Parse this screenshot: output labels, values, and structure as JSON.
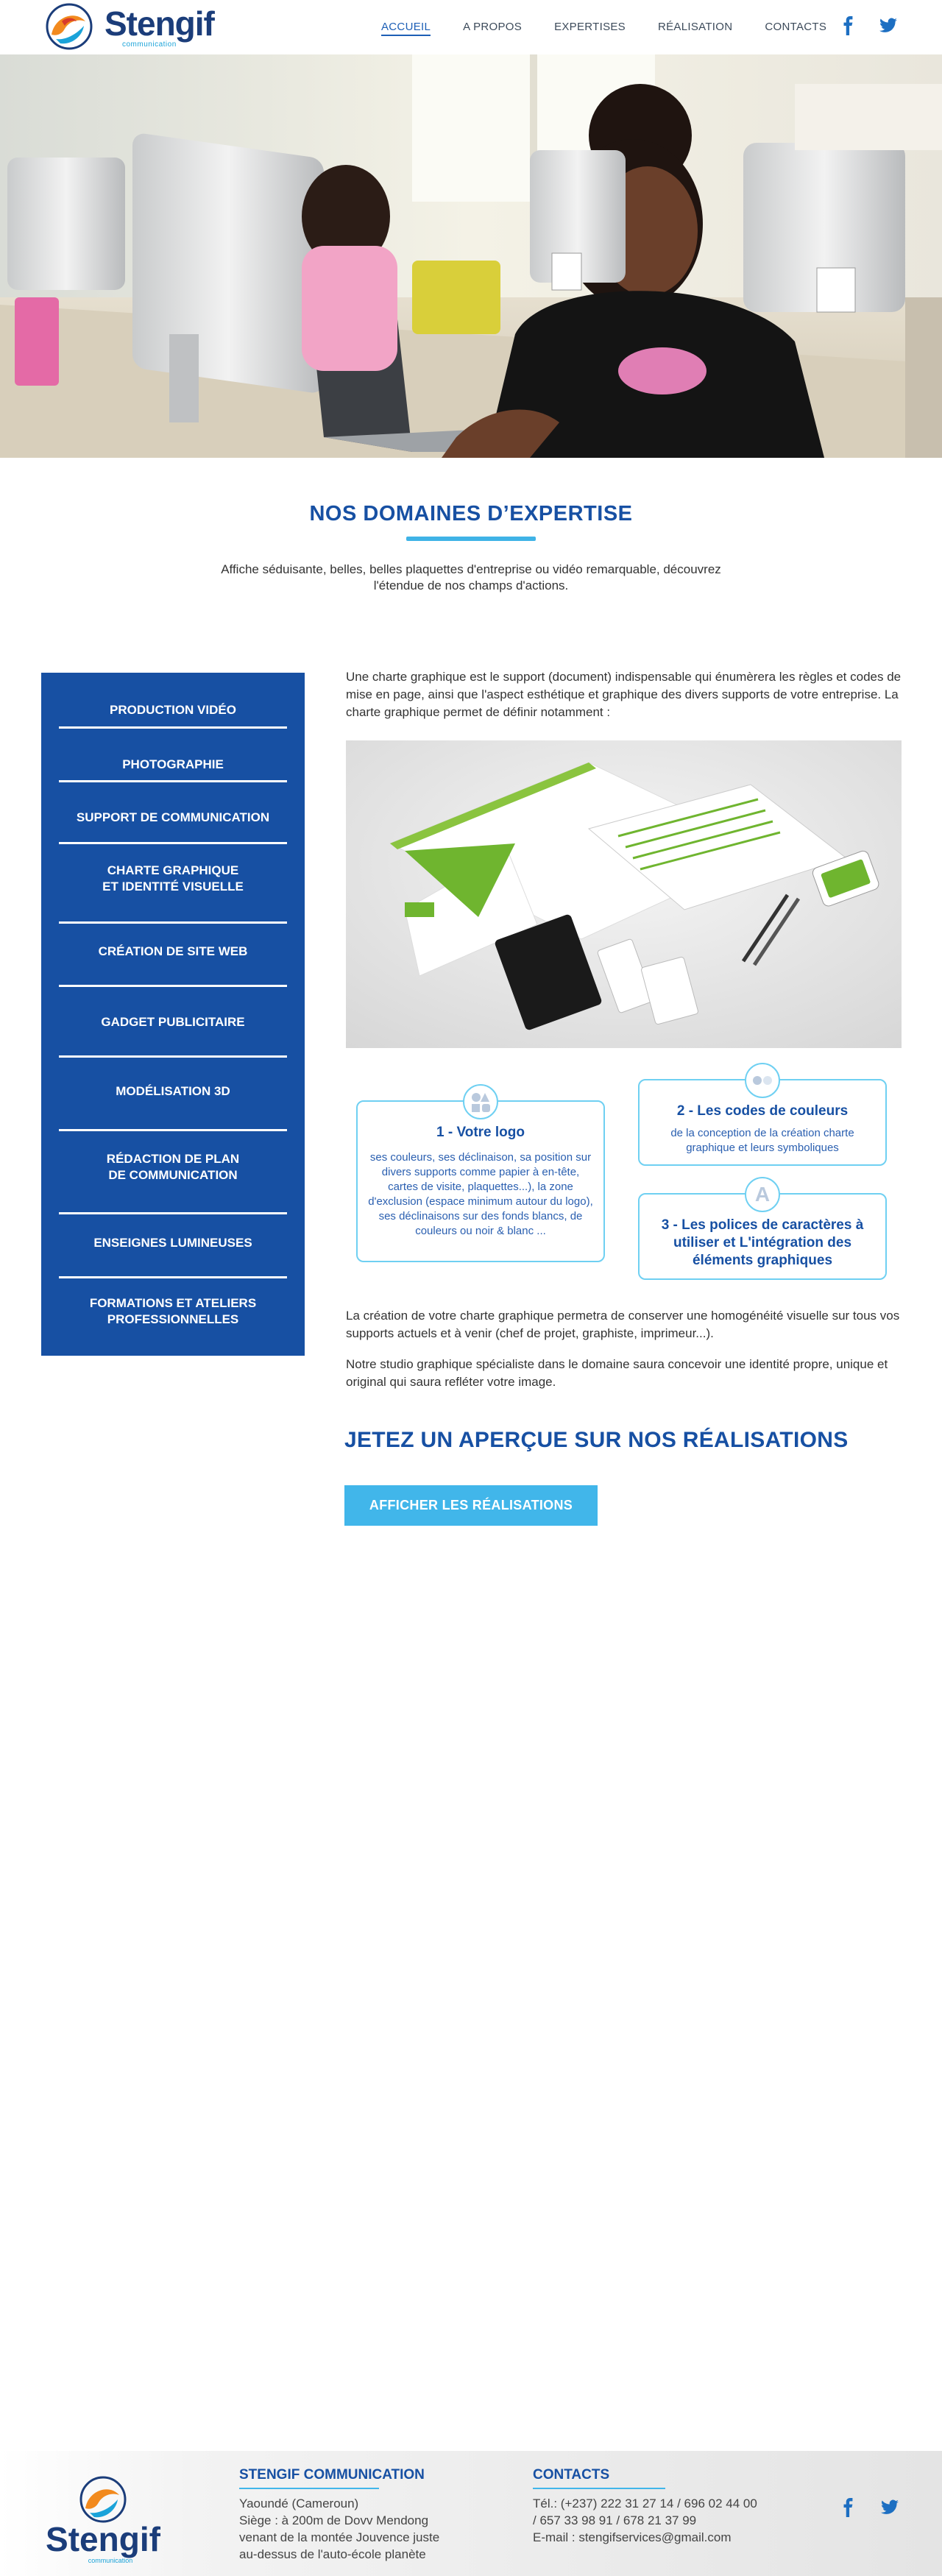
{
  "brand": {
    "name": "Stengif",
    "tagline": "communication",
    "colors": {
      "primary": "#1750a3",
      "accent": "#41b6ea",
      "logo_orange": "#f28a1e"
    }
  },
  "nav": {
    "items": [
      {
        "label": "ACCUEIL",
        "active": true
      },
      {
        "label": "A PROPOS",
        "active": false
      },
      {
        "label": "EXPERTISES",
        "active": false
      },
      {
        "label": "RÉALISATION",
        "active": false
      },
      {
        "label": "CONTACTS",
        "active": false
      }
    ],
    "social": [
      "facebook-icon",
      "twitter-icon"
    ]
  },
  "domains": {
    "title": "NOS DOMAINES D’EXPERTISE",
    "subtitle": "Affiche séduisante, belles, belles plaquettes d'entreprise ou vidéo remarquable, découvrez l'étendue de nos champs d'actions."
  },
  "menu": {
    "items": [
      "PRODUCTION VIDÉO",
      "PHOTOGRAPHIE",
      "SUPPORT DE COMMUNICATION",
      "CHARTE GRAPHIQUE\nET IDENTITÉ VISUELLE",
      "CRÉATION DE SITE WEB",
      "GADGET PUBLICITAIRE",
      "MODÉLISATION 3D",
      "RÉDACTION DE PLAN\nDE COMMUNICATION",
      "ENSEIGNES LUMINEUSES",
      "FORMATIONS ET ATELIERS\nPROFESSIONNELLES"
    ]
  },
  "content": {
    "intro": "Une charte graphique est le support (document) indispensable qui énumèrera les règles et codes de mise en page, ainsi que l'aspect esthétique et graphique des divers supports de votre entreprise. La charte graphique permet de définir notamment :",
    "cards": [
      {
        "title": "1 - Votre logo",
        "text": "ses couleurs, ses déclinaison, sa position sur divers supports comme papier à en-tête, cartes de visite, plaquettes...), la zone d'exclusion (espace minimum autour du logo), ses déclinaisons sur des fonds blancs, de couleurs ou noir & blanc ..."
      },
      {
        "title": "2 - Les codes de couleurs",
        "text": "de la conception de la création charte graphique et leurs symboliques"
      },
      {
        "title": "3 - Les polices de caractères à utiliser et L'intégration des éléments graphiques",
        "text": "",
        "icon_letter": "A"
      }
    ],
    "para2": "La création de votre charte graphique permetra de conserver une homogénéité visuelle sur tous vos supports actuels et à venir (chef de projet, graphiste, imprimeur...).",
    "para3": "Notre studio graphique spécialiste dans le domaine saura concevoir une identité propre, unique et original qui saura refléter votre image."
  },
  "realisations": {
    "title": "JETEZ UN APERÇUE SUR NOS RÉALISATIONS",
    "button": "AFFICHER LES RÉALISATIONS"
  },
  "footer": {
    "company": {
      "title": "STENGIF COMMUNICATION",
      "lines": [
        "Yaoundé (Cameroun)",
        "Siège : à 200m de Dovv Mendong",
        "venant de la montée Jouvence juste",
        "au-dessus de l'auto-école planète"
      ]
    },
    "contacts": {
      "title": "CONTACTS",
      "lines": [
        "Tél.: (+237) 222 31 27 14 / 696 02 44 00",
        "/ 657 33 98 91 / 678 21 37 99",
        "E-mail : stengifservices@gmail.com"
      ]
    },
    "social": [
      "facebook-icon",
      "twitter-icon"
    ]
  }
}
